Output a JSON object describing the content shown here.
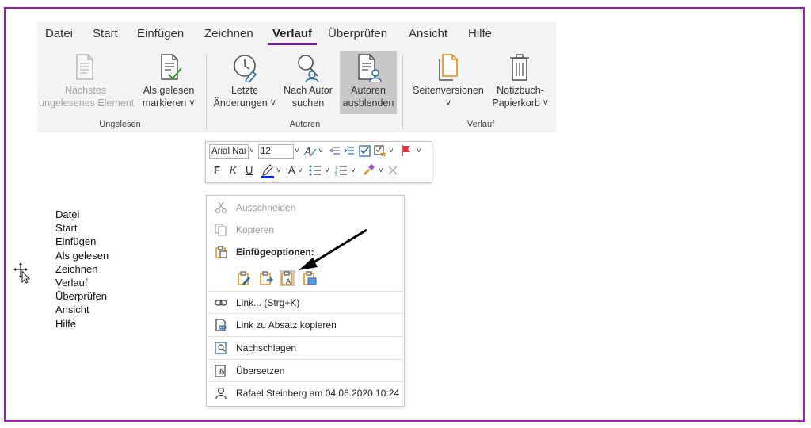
{
  "tabs": [
    "Datei",
    "Start",
    "Einfügen",
    "Zeichnen",
    "Verlauf",
    "Überprüfen",
    "Ansicht",
    "Hilfe"
  ],
  "active_tab": "Verlauf",
  "ribbon": {
    "next_unread": [
      "Nächstes",
      "ungelesenes Element"
    ],
    "mark_read": [
      "Als gelesen",
      "markieren ˅"
    ],
    "recent_changes": [
      "Letzte",
      "Änderungen ˅"
    ],
    "find_by_author": [
      "Nach Autor",
      "suchen"
    ],
    "hide_authors": [
      "Autoren",
      "ausblenden"
    ],
    "page_versions": [
      "Seitenversionen",
      "˅"
    ],
    "notebook_recycle": [
      "Notizbuch-",
      "Papierkorb ˅"
    ],
    "groups": {
      "unread": "Ungelesen",
      "authors": "Autoren",
      "history": "Verlauf"
    }
  },
  "mini_toolbar": {
    "font_name": "Arial Nai",
    "font_size": "12",
    "bold": "F",
    "italic": "K",
    "underline": "U",
    "font_color_glyph": "A"
  },
  "context_menu": {
    "cut": "Ausschneiden",
    "copy": "Kopieren",
    "paste_options": "Einfügeoptionen:",
    "link": "Link...  (Strg+K)",
    "copy_paragraph_link": "Link zu Absatz kopieren",
    "lookup": "Nachschlagen",
    "translate": "Übersetzen",
    "author_info": "Rafael Steinberg am 04.06.2020 10:24"
  },
  "pasted_list": [
    "Datei",
    "Start",
    "Einfügen",
    "Als gelesen",
    "Zeichnen",
    "Verlauf",
    "Überprüfen",
    "Ansicht",
    "Hilfe"
  ],
  "colors": {
    "accent": "#7719aa",
    "frame": "#a21dbb",
    "ribbon_bg": "#f3f3f3",
    "paste_orange": "#e38b12"
  }
}
